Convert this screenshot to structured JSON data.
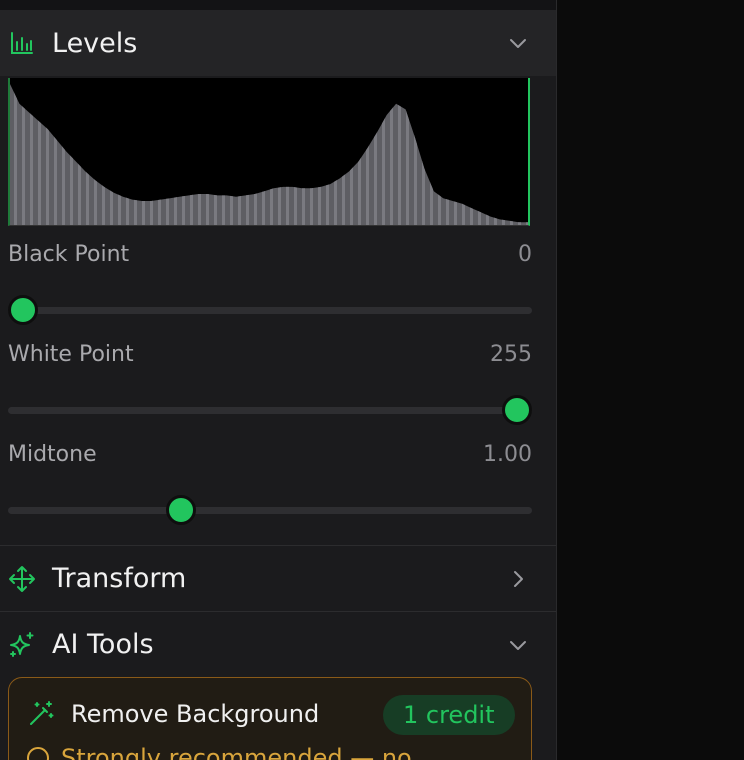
{
  "colors": {
    "accent": "#22c55e",
    "panel_bg": "#1b1b1d",
    "warning": "#d9a53c"
  },
  "levels": {
    "title": "Levels",
    "icon": "bar-chart-icon",
    "expanded": true,
    "black_point": {
      "label": "Black Point",
      "value": "0",
      "fraction": 0.0
    },
    "white_point": {
      "label": "White Point",
      "value": "255",
      "fraction": 1.0
    },
    "midtone": {
      "label": "Midtone",
      "value": "1.00",
      "fraction": 0.32
    },
    "histogram_bins": [
      1,
      0.86,
      0.8,
      0.74,
      0.68,
      0.6,
      0.52,
      0.45,
      0.38,
      0.32,
      0.27,
      0.23,
      0.2,
      0.18,
      0.17,
      0.17,
      0.18,
      0.19,
      0.2,
      0.21,
      0.22,
      0.22,
      0.21,
      0.21,
      0.2,
      0.21,
      0.22,
      0.24,
      0.26,
      0.27,
      0.27,
      0.26,
      0.26,
      0.27,
      0.29,
      0.33,
      0.38,
      0.45,
      0.55,
      0.66,
      0.78,
      0.86,
      0.82,
      0.62,
      0.4,
      0.24,
      0.19,
      0.17,
      0.15,
      0.12,
      0.09,
      0.06,
      0.04,
      0.03,
      0.02,
      0.02
    ]
  },
  "transform": {
    "title": "Transform",
    "icon": "move-arrows-icon",
    "expanded": false
  },
  "ai_tools": {
    "title": "AI Tools",
    "icon": "sparkles-icon",
    "expanded": true,
    "remove_background": {
      "label": "Remove Background",
      "credit": "1 credit",
      "note": "Strongly recommended — no"
    }
  }
}
